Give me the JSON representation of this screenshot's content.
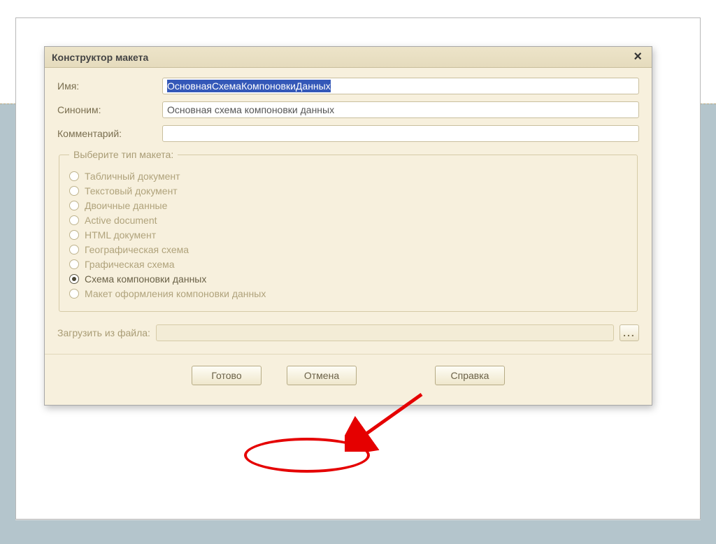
{
  "dialog": {
    "title": "Конструктор макета",
    "fields": {
      "name_label": "Имя:",
      "name_value": "ОсновнаяСхемаКомпоновкиДанных",
      "synonym_label": "Синоним:",
      "synonym_value": "Основная схема компоновки данных",
      "comment_label": "Комментарий:",
      "comment_value": ""
    },
    "group_legend": "Выберите тип макета:",
    "radios": [
      {
        "label": "Табличный документ"
      },
      {
        "label": "Текстовый документ"
      },
      {
        "label": "Двоичные данные"
      },
      {
        "label": "Active document"
      },
      {
        "label": "HTML документ"
      },
      {
        "label": "Географическая схема"
      },
      {
        "label": "Графическая схема"
      },
      {
        "label": "Схема компоновки данных"
      },
      {
        "label": "Макет оформления компоновки данных"
      }
    ],
    "selected_radio_index": 7,
    "load_label": "Загрузить из файла:",
    "browse_label": "...",
    "buttons": {
      "ok": "Готово",
      "cancel": "Отмена",
      "help": "Справка"
    }
  }
}
